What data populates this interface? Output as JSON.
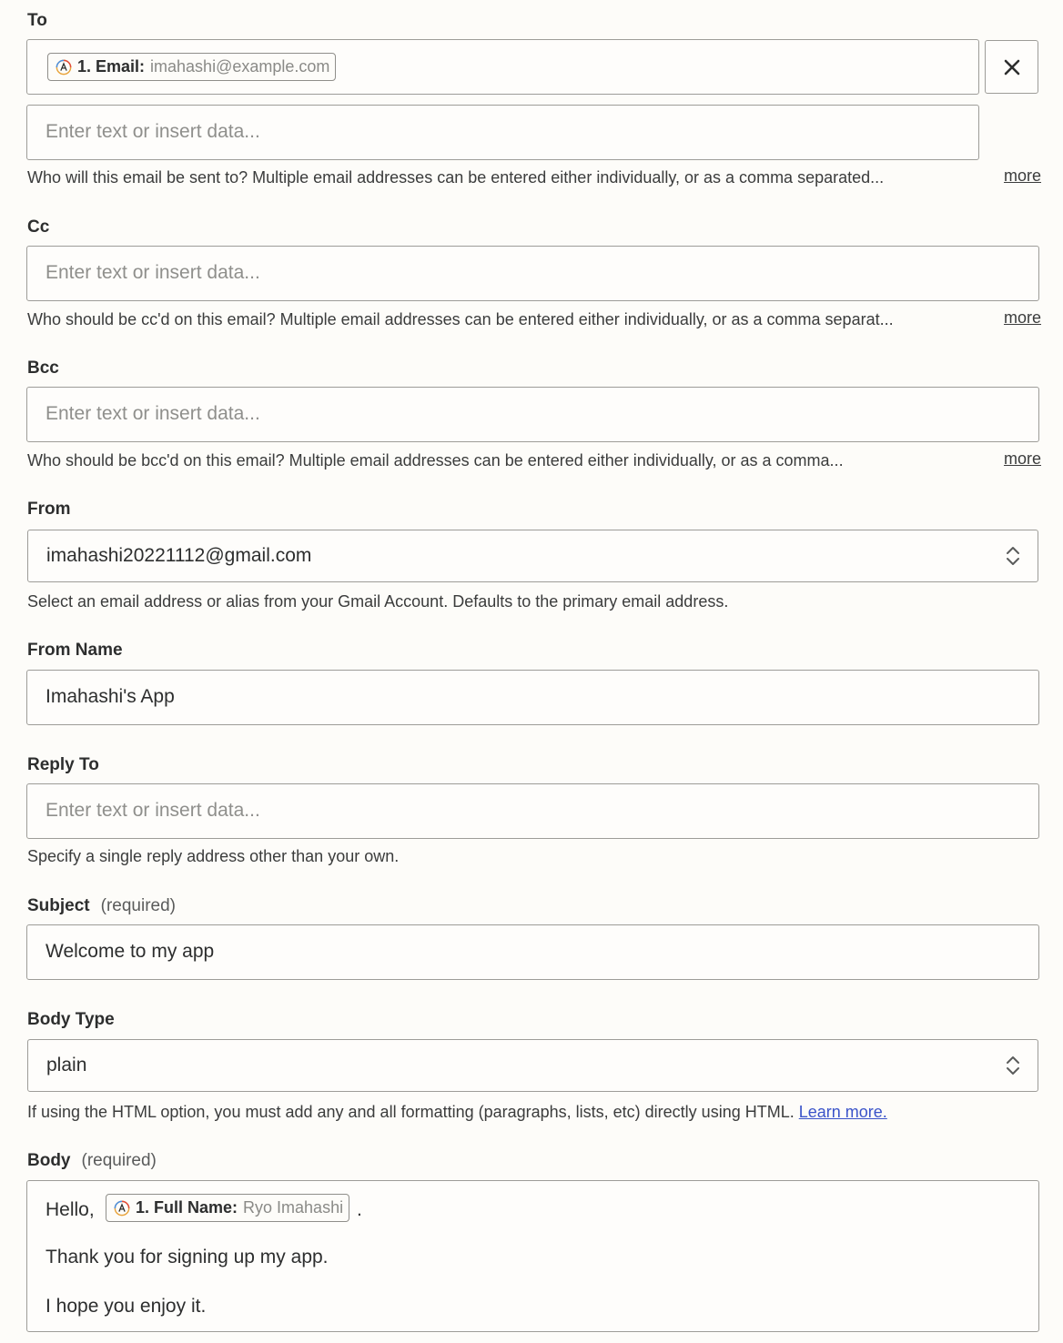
{
  "to": {
    "label": "To",
    "pill_key": "1. Email:",
    "pill_value": "imahashi@example.com",
    "placeholder": "Enter text or insert data...",
    "help": "Who will this email be sent to? Multiple email addresses can be entered either individually, or as a comma separated...",
    "more": "more"
  },
  "cc": {
    "label": "Cc",
    "placeholder": "Enter text or insert data...",
    "help": "Who should be cc'd on this email? Multiple email addresses can be entered either individually, or as a comma separat...",
    "more": "more"
  },
  "bcc": {
    "label": "Bcc",
    "placeholder": "Enter text or insert data...",
    "help": "Who should be bcc'd on this email? Multiple email addresses can be entered either individually, or as a comma...",
    "more": "more"
  },
  "from": {
    "label": "From",
    "value": "imahashi20221112@gmail.com",
    "help": "Select an email address or alias from your Gmail Account. Defaults to the primary email address."
  },
  "from_name": {
    "label": "From Name",
    "value": "Imahashi's App"
  },
  "reply_to": {
    "label": "Reply To",
    "placeholder": "Enter text or insert data...",
    "help": "Specify a single reply address other than your own."
  },
  "subject": {
    "label": "Subject",
    "required": "(required)",
    "value": "Welcome to my app"
  },
  "body_type": {
    "label": "Body Type",
    "value": "plain",
    "help": "If using the HTML option, you must add any and all formatting (paragraphs, lists, etc) directly using HTML.",
    "link": "Learn more."
  },
  "body": {
    "label": "Body",
    "required": "(required)",
    "greeting": "Hello,",
    "pill_key": "1. Full Name:",
    "pill_value": "Ryo Imahashi",
    "period": ".",
    "line2": "Thank you for signing up my app.",
    "line3": "I hope you enjoy it."
  }
}
